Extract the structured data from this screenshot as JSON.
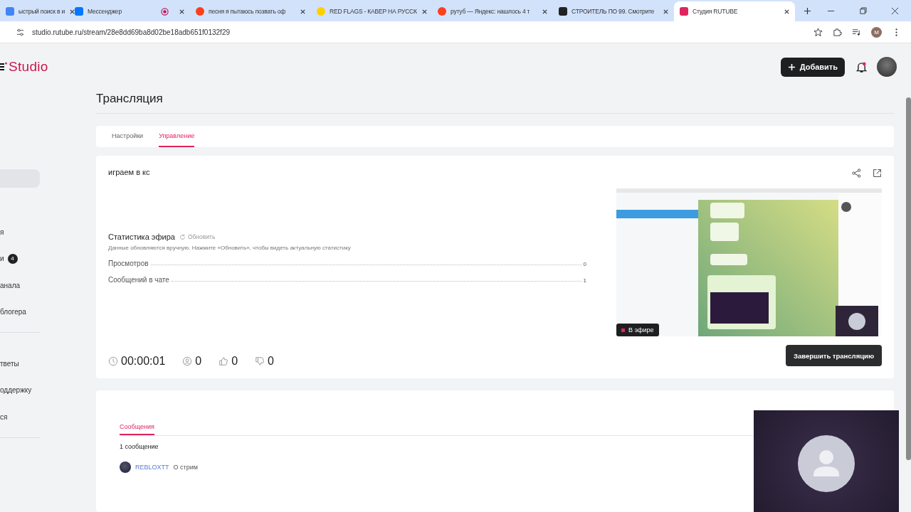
{
  "browser": {
    "tabs": [
      {
        "kind": "search",
        "title": "ыстрый поиск в и",
        "selected": false
      },
      {
        "kind": "vk",
        "title": "Мессенджер",
        "recording": true,
        "selected": false
      },
      {
        "kind": "yandex",
        "title": "песня я пытаюсь позвать оф",
        "selected": false
      },
      {
        "kind": "play",
        "title": "RED FLAGS - КАВЕР НА РУССК",
        "selected": false
      },
      {
        "kind": "yandex",
        "title": "рутуб — Яндекс: нашлось 4 т",
        "selected": false
      },
      {
        "kind": "square",
        "title": "СТРОИТЕЛЬ ПО 99. Смотрите",
        "selected": false
      },
      {
        "kind": "studio",
        "title": "Студия RUTUBE",
        "selected": true
      }
    ],
    "address": "studio.rutube.ru/stream/28e8dd69ba8d02be18adb651f0132f29",
    "profile_initial": "M"
  },
  "header": {
    "logo": "Studio",
    "add_button": "Добавить"
  },
  "sidebar": {
    "groups": [
      [
        {
          "selected": true
        },
        {
          "label": "я",
          "selected": false
        },
        {
          "label": "и",
          "badge": "4",
          "selected": false
        },
        {
          "label": "анала",
          "selected": false
        },
        {
          "label": "блогера",
          "selected": false
        }
      ],
      [
        {
          "label": "тветы",
          "selected": false
        },
        {
          "label": "оддержку",
          "selected": false
        },
        {
          "label": "ся",
          "selected": false
        }
      ]
    ]
  },
  "page_title": "Трансляция",
  "tabs": [
    {
      "label": "Настройки",
      "selected": false
    },
    {
      "label": "Управление",
      "selected": true
    }
  ],
  "stream": {
    "title": "играем в кс",
    "stats": {
      "title": "Статистика эфира",
      "refresh": "Обновить",
      "note": "Данные обновляются вручную. Нажмите «Обновить», чтобы видеть актуальную статистику",
      "rows": [
        {
          "label": "Просмотров",
          "value": "0"
        },
        {
          "label": "Сообщений в чате",
          "value": "1"
        }
      ]
    },
    "counters": [
      {
        "kind": "time",
        "value": "00:00:01"
      },
      {
        "kind": "viewers",
        "value": "0"
      },
      {
        "kind": "likes",
        "value": "0"
      },
      {
        "kind": "dislikes",
        "value": "0"
      }
    ],
    "preview": {
      "kind": "picture",
      "live_badge": "В эфире"
    },
    "end_button": "Завершить трансляцию"
  },
  "messages": {
    "tab": "Сообщения",
    "count": "1 сообщение",
    "items": [
      {
        "author": "REBLOXTT",
        "text": "О стрим"
      }
    ]
  }
}
